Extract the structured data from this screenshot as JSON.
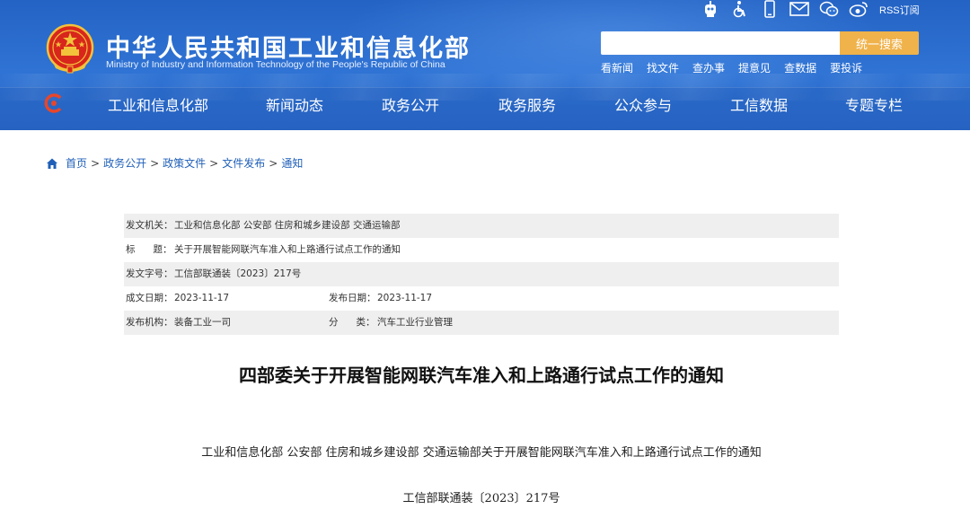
{
  "header": {
    "site_name": "中华人民共和国工业和信息化部",
    "site_name_en": "Ministry of Industry and Information Technology of the People's Republic of China",
    "rss_label": "RSS订阅",
    "top_icons": [
      "robot-icon",
      "accessibility-icon",
      "mobile-icon",
      "mail-icon",
      "wechat-icon",
      "weibo-icon"
    ],
    "search": {
      "placeholder": "",
      "button_label": "统一搜索"
    },
    "quick_links": [
      "看新闻",
      "找文件",
      "查办事",
      "提意见",
      "查数据",
      "要投诉"
    ],
    "colors": {
      "header_blue": "#2f73d4",
      "search_button": "#f0b24a",
      "link_blue": "#1f5fb8"
    }
  },
  "nav": {
    "items": [
      "工业和信息化部",
      "新闻动态",
      "政务公开",
      "政务服务",
      "公众参与",
      "工信数据",
      "专题专栏"
    ]
  },
  "breadcrumb": {
    "items": [
      "首页",
      "政务公开",
      "政策文件",
      "文件发布",
      "通知"
    ],
    "separator": ">"
  },
  "meta": {
    "issuer_label": "发文机关：",
    "issuer": "工业和信息化部 公安部 住房和城乡建设部 交通运输部",
    "title_label_a": "标",
    "title_label_b": "题：",
    "title": "关于开展智能网联汽车准入和上路通行试点工作的通知",
    "doc_no_label": "发文字号：",
    "doc_no": "工信部联通装〔2023〕217号",
    "created_label": "成文日期：",
    "created": "2023-11-17",
    "published_label": "发布日期：",
    "published": "2023-11-17",
    "org_label": "发布机构：",
    "org": "装备工业一司",
    "category_label_a": "分",
    "category_label_b": "类：",
    "category": "汽车工业行业管理"
  },
  "document": {
    "title": "四部委关于开展智能网联汽车准入和上路通行试点工作的通知",
    "subtitle": "工业和信息化部 公安部 住房和城乡建设部 交通运输部关于开展智能网联汽车准入和上路通行试点工作的通知",
    "doc_number": "工信部联通装〔2023〕217号"
  }
}
